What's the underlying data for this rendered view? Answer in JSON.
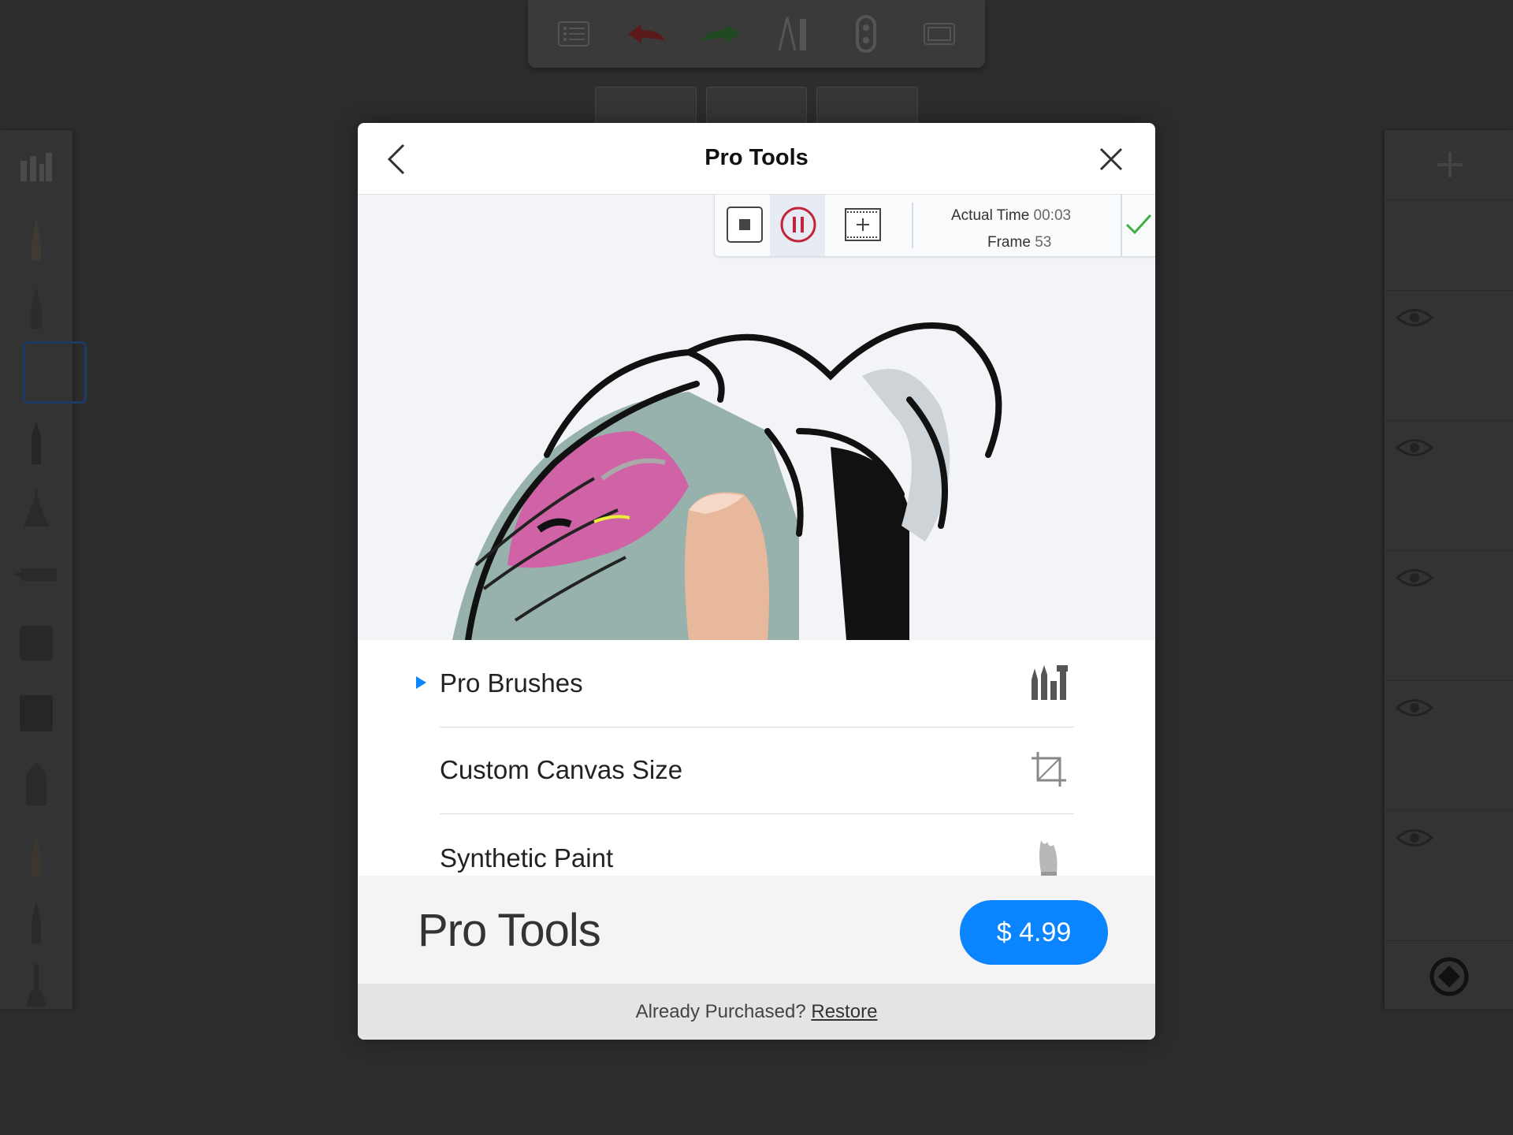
{
  "app_toolbar": {
    "icons": [
      "list-icon",
      "undo-icon",
      "redo-icon",
      "ruler-compass-icon",
      "lock-icon",
      "canvas-frame-icon"
    ]
  },
  "modal": {
    "title": "Pro Tools",
    "back_icon": "chevron-left-icon",
    "close_icon": "close-icon",
    "recording": {
      "actual_time_label": "Actual Time",
      "actual_time_value": "00:03",
      "frame_label": "Frame",
      "frame_value": "53"
    },
    "features": [
      {
        "label": "Pro Brushes",
        "icon": "brushes-icon",
        "selected": true
      },
      {
        "label": "Custom Canvas Size",
        "icon": "crop-icon",
        "selected": false
      },
      {
        "label": "Synthetic Paint",
        "icon": "paint-brush-icon",
        "selected": false
      }
    ],
    "product_name": "Pro Tools",
    "price": "$ 4.99",
    "already_purchased": "Already Purchased?",
    "restore_label": "Restore"
  },
  "colors": {
    "accent": "#0a84ff",
    "undo_red": "#b02020",
    "redo_green": "#2e8b2e",
    "background": "#2d2d2d"
  }
}
